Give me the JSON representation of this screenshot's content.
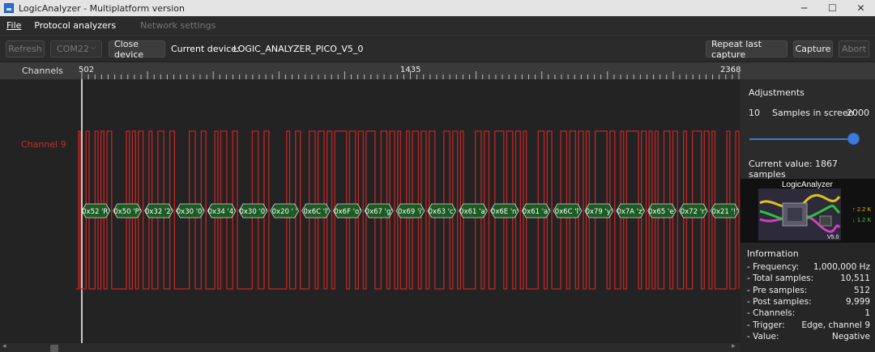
{
  "window": {
    "title": "LogicAnalyzer - Multiplatform version",
    "controls": [
      "─",
      "☐",
      "✕"
    ]
  },
  "menu": {
    "file": "File",
    "protocol_analyzers": "Protocol analyzers",
    "network_settings": "Network settings"
  },
  "toolbar": {
    "refresh": "Refresh",
    "port": "COM22",
    "close_device": "Close device",
    "current_device_label": "Current device:",
    "current_device_value": "LOGIC_ANALYZER_PICO_V5_0",
    "repeat_last_capture": "Repeat last capture",
    "capture": "Capture",
    "abort": "Abort"
  },
  "ruler": {
    "channels_header": "Channels",
    "start": "502",
    "mid": "1435",
    "end": "2368"
  },
  "channel": {
    "name": "Channel 9",
    "color": "#c42424"
  },
  "decoded": [
    "0x52 'R'",
    "0x50 'P'",
    "0x32 '2'",
    "0x30 '0'",
    "0x34 '4'",
    "0x30 '0'",
    "0x20 ' '",
    "0x6C 'l'",
    "0x6F 'o'",
    "0x67 'g'",
    "0x69 'i'",
    "0x63 'c'",
    "0x61 'a'",
    "0x6E 'n'",
    "0x61 'a'",
    "0x6C 'l'",
    "0x79 'y'",
    "0x7A 'z'",
    "0x65 'e'",
    "0x72 'r'",
    "0x21 '!'"
  ],
  "adjustments": {
    "title": "Adjustments",
    "min": "10",
    "samples_label": "Samples in screen",
    "max": "2000",
    "slider_fraction": 1.0,
    "current_value": "Current value:  1867 samples"
  },
  "device_image": {
    "brand": "LogicAnalyzer",
    "version": "V5.0",
    "stat_up": "↑ 2.2 K",
    "stat_down": "↓ 1.2 K"
  },
  "information": {
    "title": "Information",
    "rows": [
      {
        "label": "- Frequency:",
        "value": "1,000,000 Hz"
      },
      {
        "label": "- Total samples:",
        "value": "10,511"
      },
      {
        "label": "- Pre samples:",
        "value": "512"
      },
      {
        "label": "- Post samples:",
        "value": "9,999"
      },
      {
        "label": "- Channels:",
        "value": "1"
      },
      {
        "label": "- Trigger:",
        "value": "Edge, channel 9"
      },
      {
        "label": "- Value:",
        "value": "Negative"
      }
    ]
  }
}
